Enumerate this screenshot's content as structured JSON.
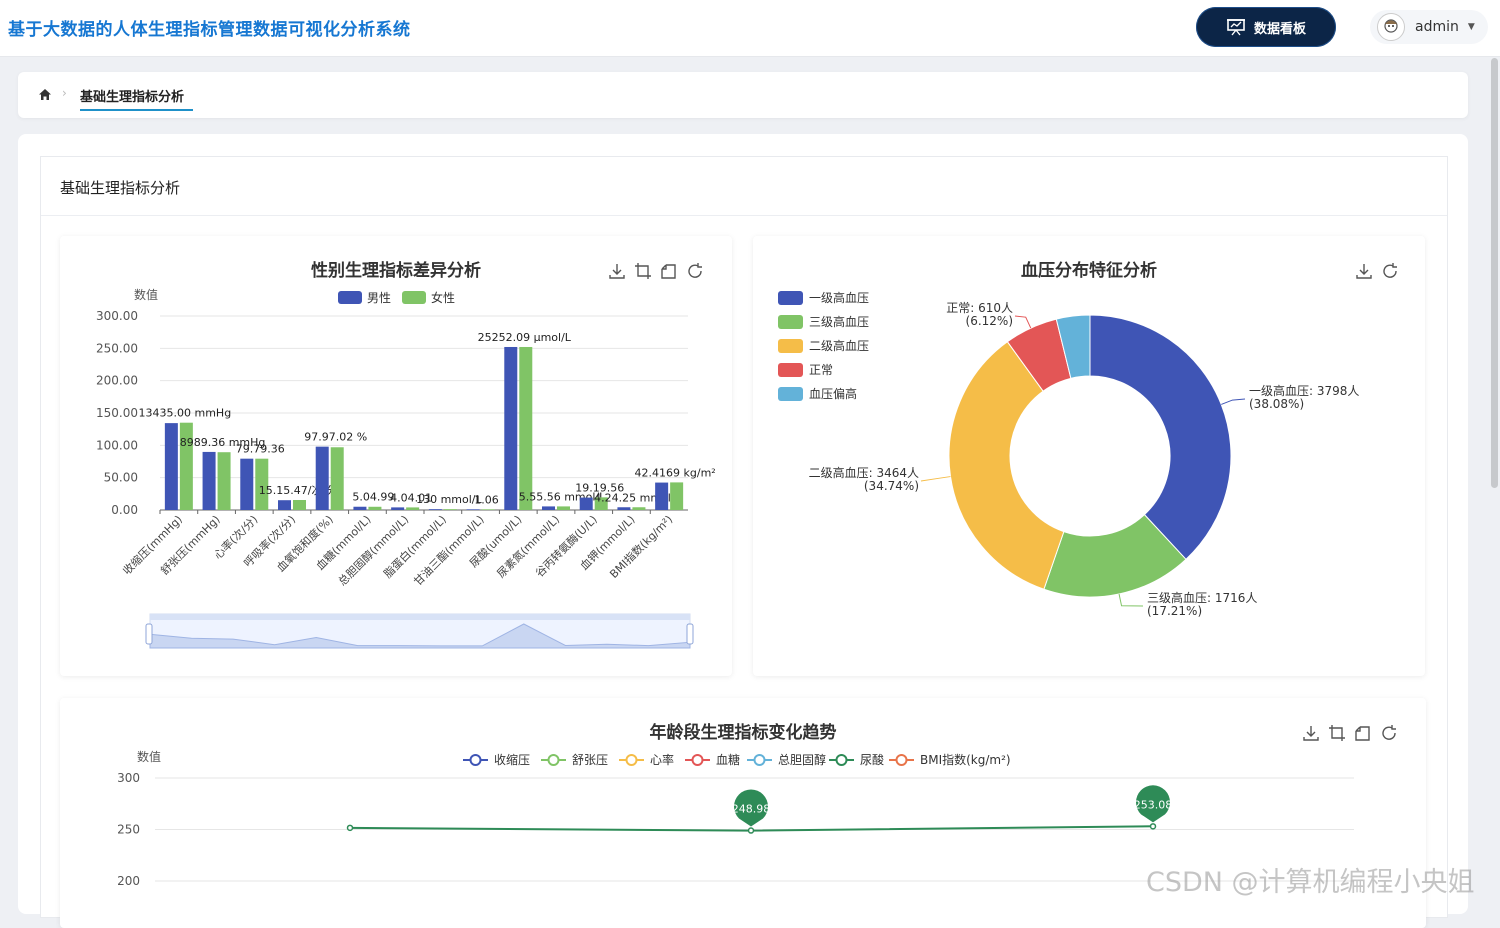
{
  "app": {
    "title": "基于大数据的人体生理指标管理数据可视化分析系统",
    "dashboard_button": "数据看板",
    "user": "admin"
  },
  "breadcrumb": {
    "current": "基础生理指标分析"
  },
  "card": {
    "title": "基础生理指标分析"
  },
  "colors": {
    "male": "#3f55b5",
    "female": "#80c466",
    "accent": "#1677d2",
    "line": "#2e8b57"
  },
  "chart_data": [
    {
      "type": "bar",
      "title": "性别生理指标差异分析",
      "ylabel": "数值",
      "ylim": [
        0,
        300
      ],
      "yticks": [
        "0.00",
        "50.00",
        "100.00",
        "150.00",
        "200.00",
        "250.00",
        "300.00"
      ],
      "categories": [
        "收缩压(mmHg)",
        "舒张压(mmHg)",
        "心率(次/分)",
        "呼吸率(次/分)",
        "血氧饱和度(%)",
        "血糖(mmol/L)",
        "总胆固醇(mmol/L)",
        "脂蛋白(mmol/L)",
        "甘油三酯(mmol/L)",
        "尿酸(umol/L)",
        "尿素氮(mmol/L)",
        "谷丙转氨酶(U/L)",
        "血钾(mmol/L)",
        "BMI指数(kg/m²)"
      ],
      "series": [
        {
          "name": "男性",
          "values": [
            134.35,
            89.81,
            79.37,
            15.15,
            97.97,
            5.04,
            4.04,
            1.3,
            1.06,
            252.09,
            5.55,
            19.19,
            4.24,
            42.41
          ]
        },
        {
          "name": "女性",
          "values": [
            135.0,
            89.36,
            79.36,
            15.47,
            97.02,
            4.99,
            4.01,
            1.3,
            1.06,
            252.09,
            5.56,
            19.56,
            4.25,
            42.69
          ]
        }
      ],
      "data_labels": [
        "13435.00 mmHg",
        "8989.36 mmHg",
        "79.79.36",
        "15.15.47/次/分",
        "97.97.02 %",
        "5.04.99",
        "4.04.01",
        "130 mmol/L",
        "1.06",
        "25252.09 μmol/L",
        "5.55.56 mmol/L",
        "19.19.56",
        "4.24.25 mmol/L",
        "42.4169 kg/m²"
      ],
      "legend": "top-center",
      "grid": true
    },
    {
      "type": "pie",
      "title": "血压分布特征分析",
      "legend": "top-left",
      "slices": [
        {
          "name": "一级高血压",
          "value": 3798,
          "percent": 38.08,
          "label": "一级高血压: 3798人",
          "label_pct": "(38.08%)"
        },
        {
          "name": "三级高血压",
          "value": 1716,
          "percent": 17.21,
          "label": "三级高血压: 1716人",
          "label_pct": "(17.21%)"
        },
        {
          "name": "二级高血压",
          "value": 3464,
          "percent": 34.74,
          "label": "二级高血压: 3464人",
          "label_pct": "(34.74%)"
        },
        {
          "name": "正常",
          "value": 610,
          "percent": 6.12,
          "label": "正常: 610人",
          "label_pct": "(6.12%)"
        },
        {
          "name": "血压偏高",
          "value": 383,
          "percent": 3.85,
          "label": "",
          "label_pct": ""
        }
      ],
      "colors": [
        "#3f55b5",
        "#80c466",
        "#f5bd48",
        "#e35656",
        "#63b2d9"
      ]
    },
    {
      "type": "line",
      "title": "年龄段生理指标变化趋势",
      "ylabel": "数值",
      "yticks": [
        "200",
        "250",
        "300"
      ],
      "legend": "top-center",
      "series_names": [
        "收缩压",
        "舒张压",
        "心率",
        "血糖",
        "总胆固醇",
        "尿酸",
        "BMI指数(kg/m²)"
      ],
      "series_colors": [
        "#3f55b5",
        "#80c466",
        "#f5bd48",
        "#e35656",
        "#63b2d9",
        "#2e8b57",
        "#e8744a"
      ],
      "visible_series": {
        "name": "尿酸",
        "values": [
          251.6,
          248.98,
          253.08
        ],
        "markers": [
          "248.98",
          "253.08"
        ]
      },
      "grid": true
    }
  ],
  "watermark": "CSDN @计算机编程小央姐"
}
